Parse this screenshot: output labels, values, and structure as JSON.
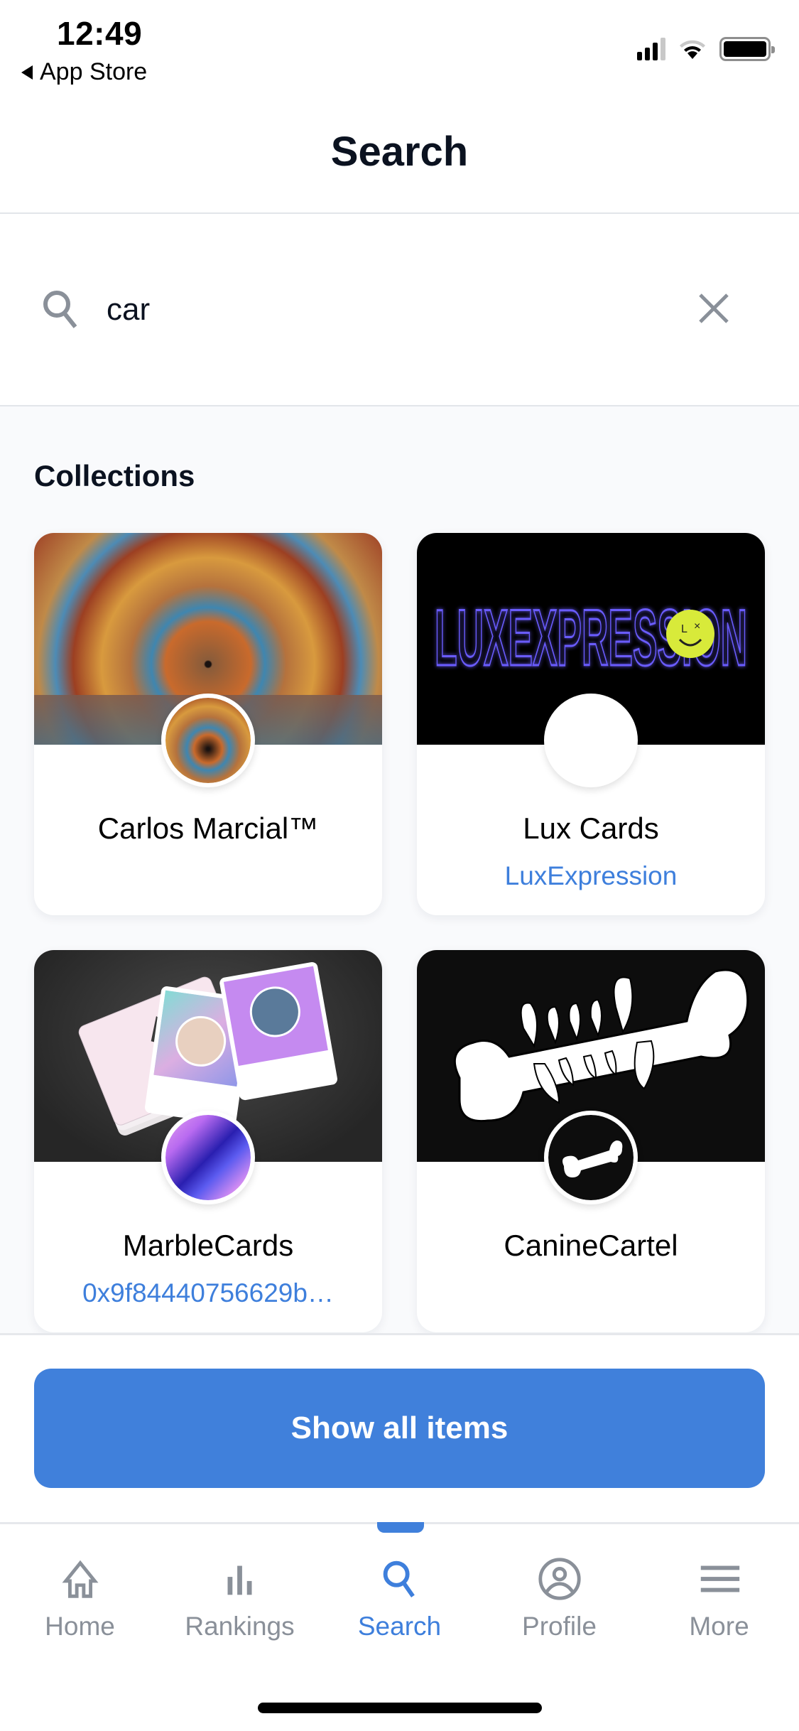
{
  "status_bar": {
    "time": "12:49",
    "back_label": "App Store",
    "icons": [
      "signal-icon",
      "wifi-icon",
      "battery-icon"
    ]
  },
  "header": {
    "title": "Search"
  },
  "search": {
    "value": "car",
    "placeholder": "",
    "search_icon": "search-icon",
    "clear_icon": "close-icon"
  },
  "collections": {
    "title": "Collections",
    "items": [
      {
        "name": "Carlos Marcial™",
        "subtitle": ""
      },
      {
        "name": "Lux Cards",
        "subtitle": "LuxExpression",
        "banner_text": "LUXEXPRESSION"
      },
      {
        "name": "MarbleCards",
        "subtitle": "0x9f84440756629b…"
      },
      {
        "name": "CanineCartel",
        "subtitle": ""
      }
    ]
  },
  "actions": {
    "show_all_label": "Show all items"
  },
  "tabbar": {
    "active": "Search",
    "items": [
      {
        "label": "Home",
        "icon": "home-icon"
      },
      {
        "label": "Rankings",
        "icon": "bar-chart-icon"
      },
      {
        "label": "Search",
        "icon": "search-icon"
      },
      {
        "label": "Profile",
        "icon": "user-circle-icon"
      },
      {
        "label": "More",
        "icon": "menu-icon"
      }
    ]
  },
  "colors": {
    "accent": "#4080db",
    "link": "#3e7fdc",
    "text_primary": "#0b1220",
    "icon_gray": "#8a9099",
    "content_bg": "#f9fafc"
  }
}
